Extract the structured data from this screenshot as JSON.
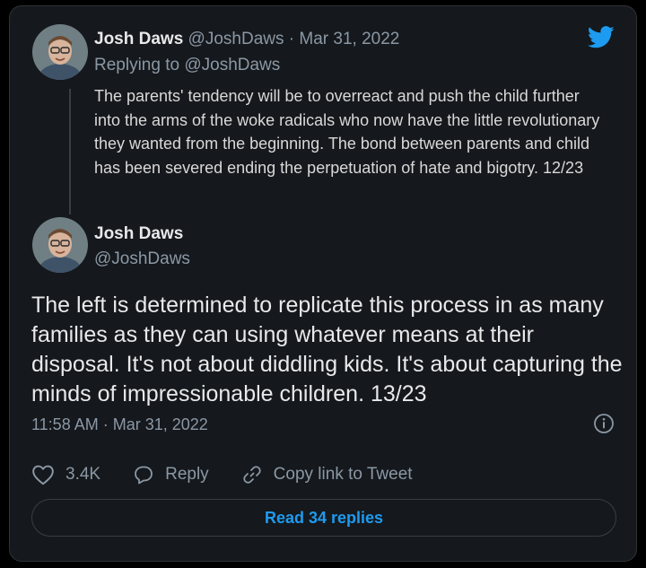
{
  "reply_tweet": {
    "author_name": "Josh Daws",
    "author_handle": "@JoshDaws",
    "separator": "·",
    "date": "Mar 31, 2022",
    "replying_prefix": "Replying to",
    "replying_handle": "@JoshDaws",
    "text": "The parents' tendency will be to overreact and push the child further into the arms of the woke radicals who now have the little revolutionary they wanted from the beginning. The bond between parents and child has been severed ending the perpetuation of hate and bigotry. 12/23"
  },
  "main_tweet": {
    "author_name": "Josh Daws",
    "author_handle": "@JoshDaws",
    "text": "The left is determined to replicate this process in as many families as they can using whatever means at their disposal. It's not about diddling kids. It's about capturing the minds of impressionable children. 13/23",
    "timestamp": "11:58 AM · Mar 31, 2022"
  },
  "actions": {
    "like_count": "3.4K",
    "reply_label": "Reply",
    "copy_link_label": "Copy link to Tweet"
  },
  "read_replies_label": "Read 34 replies",
  "icons": {
    "brand": "twitter-bird-icon",
    "info": "info-icon",
    "like": "heart-icon",
    "reply": "speech-bubble-icon",
    "copy_link": "link-icon"
  },
  "colors": {
    "background": "#15181c",
    "accent": "#1d9bf0",
    "muted": "#8b98a5",
    "text": "#e7e9ea"
  }
}
